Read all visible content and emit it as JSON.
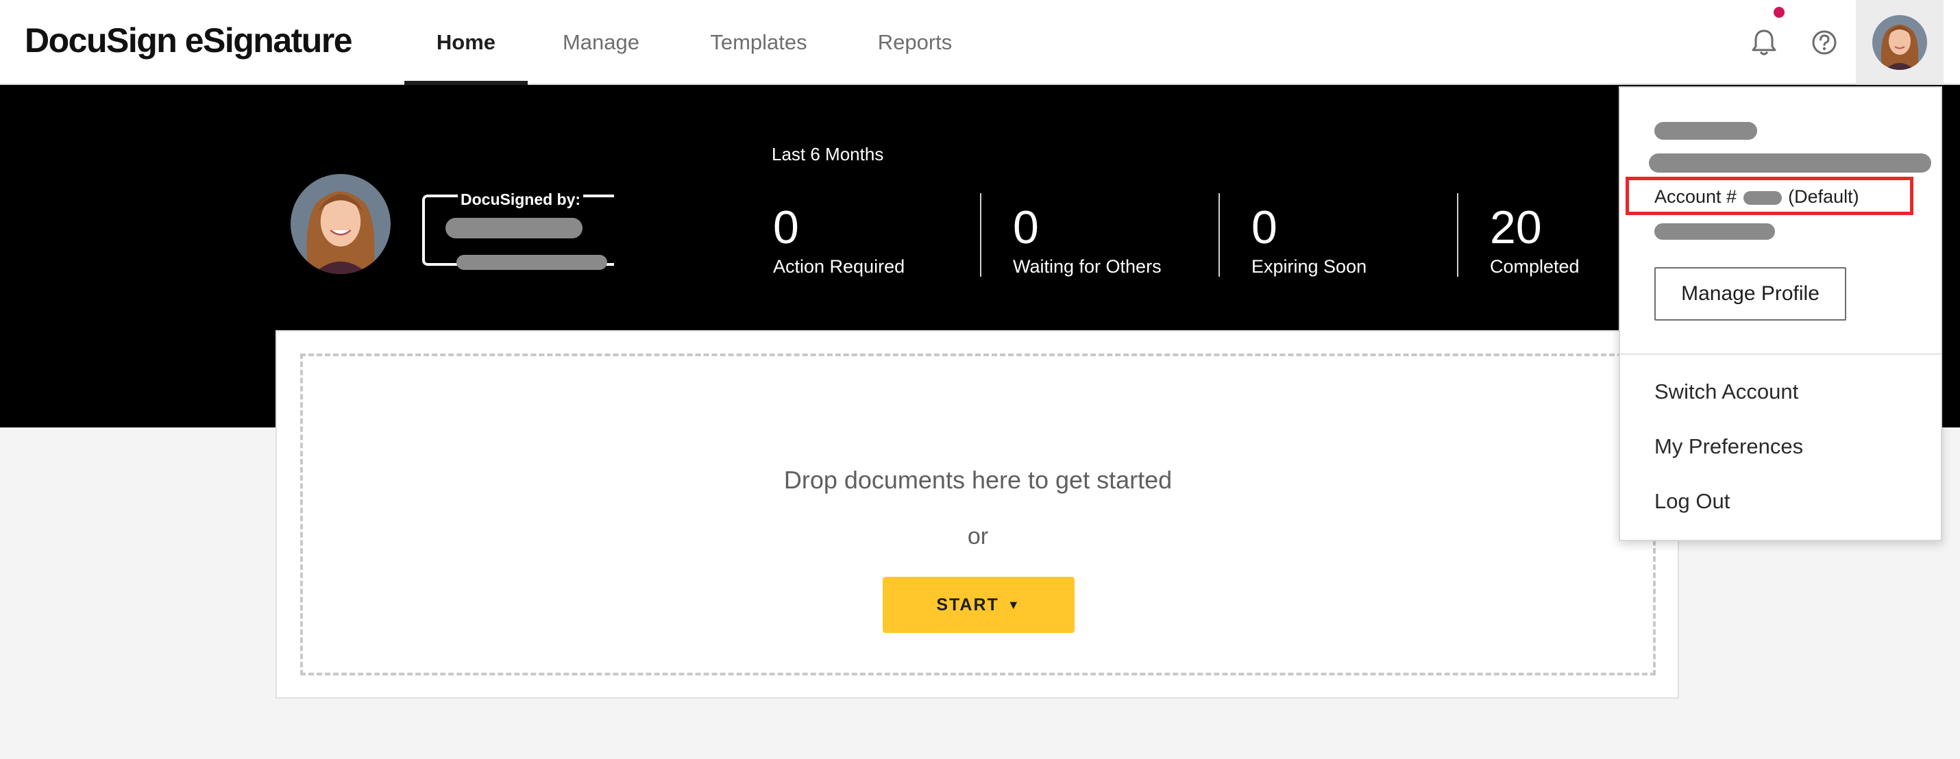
{
  "app": {
    "logo": "DocuSign eSignature"
  },
  "nav": {
    "tabs": [
      {
        "label": "Home",
        "active": true
      },
      {
        "label": "Manage",
        "active": false
      },
      {
        "label": "Templates",
        "active": false
      },
      {
        "label": "Reports",
        "active": false
      }
    ],
    "icons": [
      "bell-icon",
      "help-icon"
    ],
    "notification_indicator": true
  },
  "banner": {
    "signature_label": "DocuSigned by:",
    "period": "Last 6 Months",
    "stats": [
      {
        "value": "0",
        "label": "Action Required"
      },
      {
        "value": "0",
        "label": "Waiting for Others"
      },
      {
        "value": "0",
        "label": "Expiring Soon"
      },
      {
        "value": "20",
        "label": "Completed"
      }
    ]
  },
  "dropzone": {
    "prompt": "Drop documents here to get started",
    "or": "or",
    "start_label": "START"
  },
  "profile_menu": {
    "account_prefix": "Account #",
    "account_suffix": "(Default)",
    "manage_profile": "Manage Profile",
    "items": [
      "Switch Account",
      "My Preferences",
      "Log Out"
    ]
  },
  "colors": {
    "accent_yellow": "#ffc72c",
    "banner_bg": "#000000",
    "highlight_red": "#e8262c",
    "notification_dot": "#d0155b"
  }
}
